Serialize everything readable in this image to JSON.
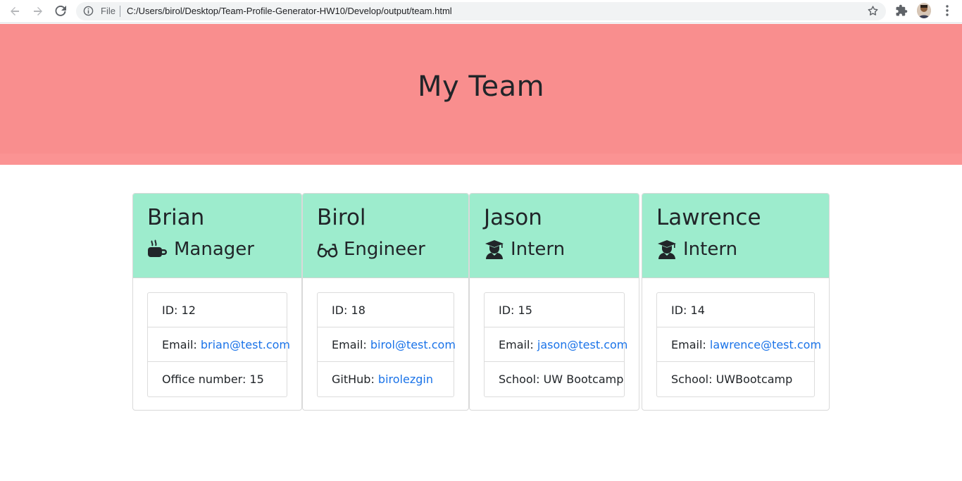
{
  "browser": {
    "file_label": "File",
    "url": "C:/Users/birol/Desktop/Team-Profile-Generator-HW10/Develop/output/team.html"
  },
  "page": {
    "title": "My Team"
  },
  "members": [
    {
      "name": "Brian",
      "role": "Manager",
      "role_icon": "mug-icon",
      "id_label": "ID: 12",
      "email_label": "Email: ",
      "email": "brian@test.com",
      "extra_label": "Office number: 15",
      "extra_link": ""
    },
    {
      "name": "Birol",
      "role": "Engineer",
      "role_icon": "glasses-icon",
      "id_label": "ID: 18",
      "email_label": "Email: ",
      "email": "birol@test.com",
      "extra_label": "GitHub: ",
      "extra_link": "birolezgin"
    },
    {
      "name": "Jason",
      "role": "Intern",
      "role_icon": "graduate-icon",
      "id_label": "ID: 15",
      "email_label": "Email: ",
      "email": "jason@test.com",
      "extra_label": "School: UW Bootcamp",
      "extra_link": ""
    },
    {
      "name": "Lawrence",
      "role": "Intern",
      "role_icon": "graduate-icon",
      "id_label": "ID: 14",
      "email_label": "Email: ",
      "email": "lawrence@test.com",
      "extra_label": "School: UWBootcamp",
      "extra_link": ""
    }
  ],
  "colors": {
    "header_bg": "#f98e8e",
    "card_header_bg": "#9deccd",
    "link": "#1a73e8"
  }
}
